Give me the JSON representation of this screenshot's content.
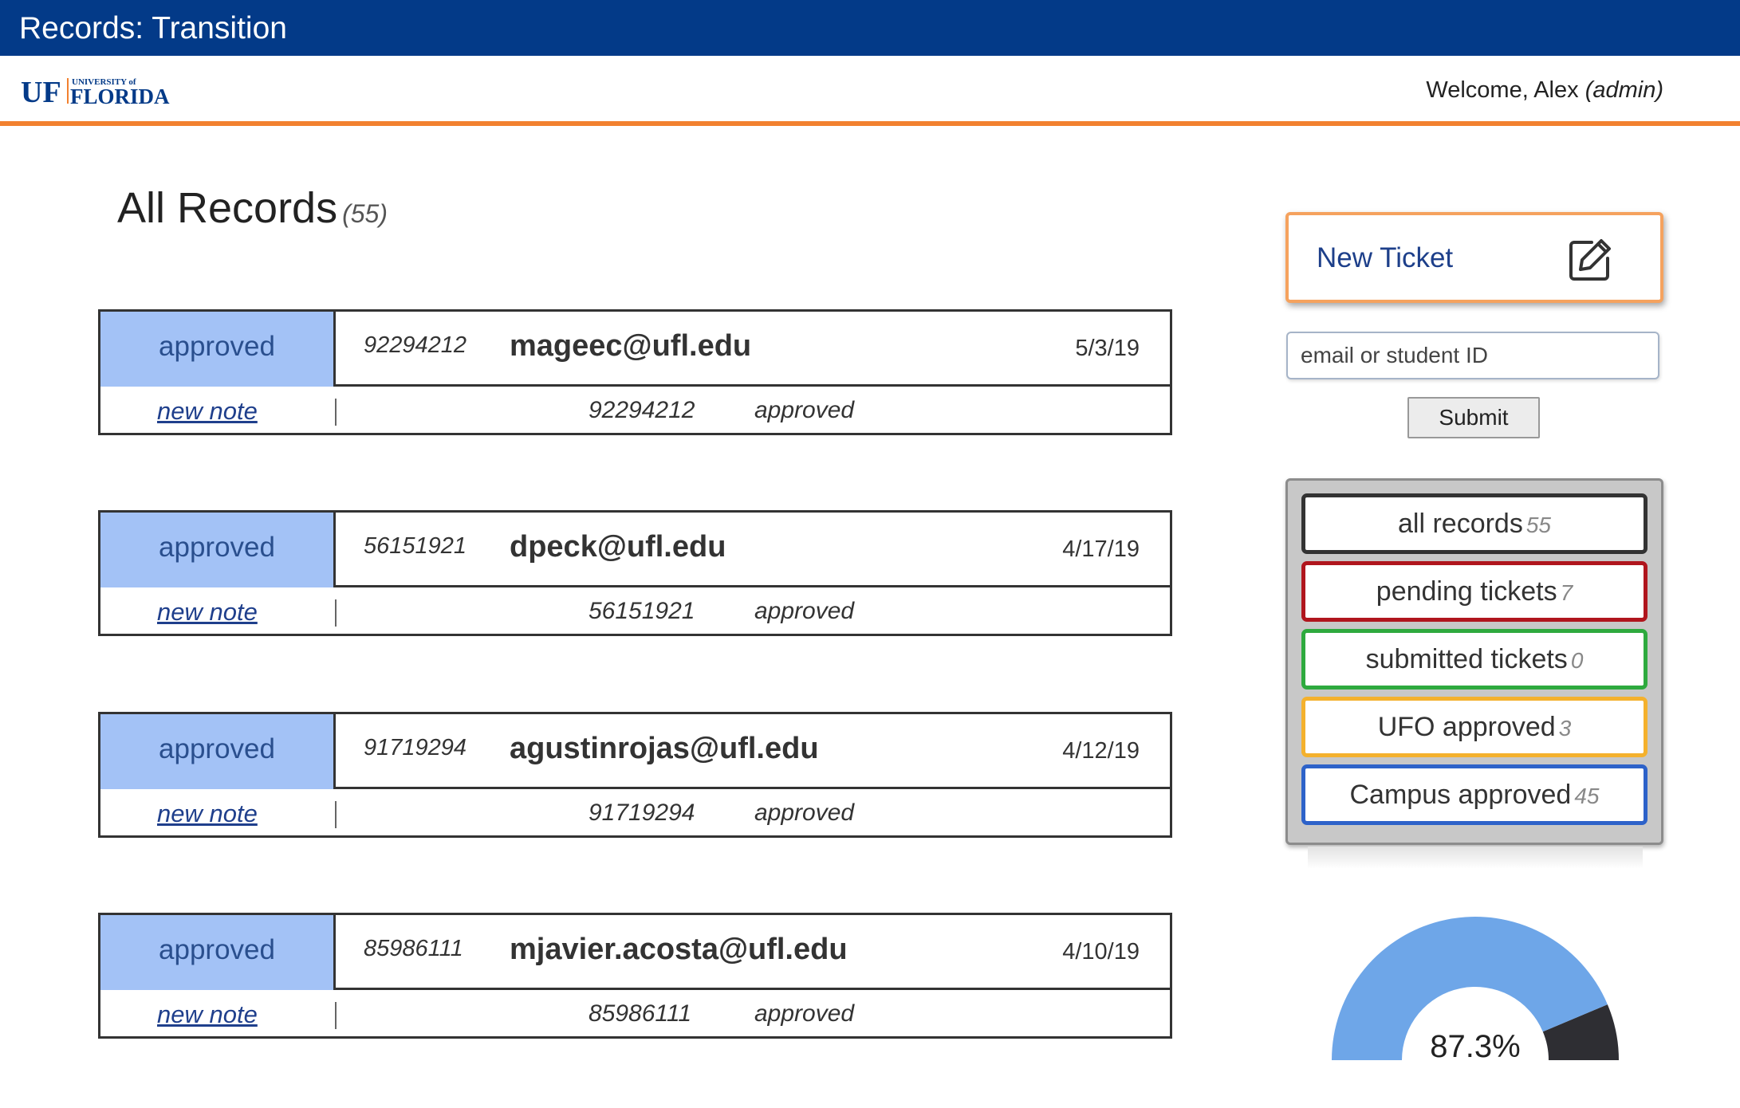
{
  "app": {
    "title": "Records: Transition"
  },
  "header": {
    "welcome_prefix": "Welcome, Alex ",
    "role": "(admin)",
    "logo_text": "UF UNIVERSITY of FLORIDA"
  },
  "page": {
    "title": "All Records",
    "count": "(55)"
  },
  "records": [
    {
      "status": "approved",
      "student_id": "92294212",
      "email": "mageec@ufl.edu",
      "date": "5/3/19",
      "note_link": "new note",
      "detail_id": "92294212",
      "detail_status": "approved"
    },
    {
      "status": "approved",
      "student_id": "56151921",
      "email": "dpeck@ufl.edu",
      "date": "4/17/19",
      "note_link": "new note",
      "detail_id": "56151921",
      "detail_status": "approved"
    },
    {
      "status": "approved",
      "student_id": "91719294",
      "email": "agustinrojas@ufl.edu",
      "date": "4/12/19",
      "note_link": "new note",
      "detail_id": "91719294",
      "detail_status": "approved"
    },
    {
      "status": "approved",
      "student_id": "85986111",
      "email": "mjavier.acosta@ufl.edu",
      "date": "4/10/19",
      "note_link": "new note",
      "detail_id": "85986111",
      "detail_status": "approved"
    }
  ],
  "sidebar": {
    "new_ticket_label": "New Ticket",
    "new_ticket_icon": "edit-icon",
    "search_placeholder": "email or student ID",
    "submit_label": "Submit",
    "filters": [
      {
        "label": "all records",
        "count": "55",
        "border": "#333333"
      },
      {
        "label": "pending tickets",
        "count": "7",
        "border": "#b0151d"
      },
      {
        "label": "submitted tickets",
        "count": "0",
        "border": "#2eaa3e"
      },
      {
        "label": "UFO approved",
        "count": "3",
        "border": "#f4b12d"
      },
      {
        "label": "Campus approved",
        "count": "45",
        "border": "#2d62c9"
      }
    ]
  },
  "gauge": {
    "value_fraction": 0.873,
    "label": "87.3%",
    "fill_color": "#6ea6e8",
    "rest_color": "#2e2e33"
  },
  "colors": {
    "topbar": "#033a88",
    "accent": "#f2812f",
    "status_fill": "#a3c2f6"
  }
}
